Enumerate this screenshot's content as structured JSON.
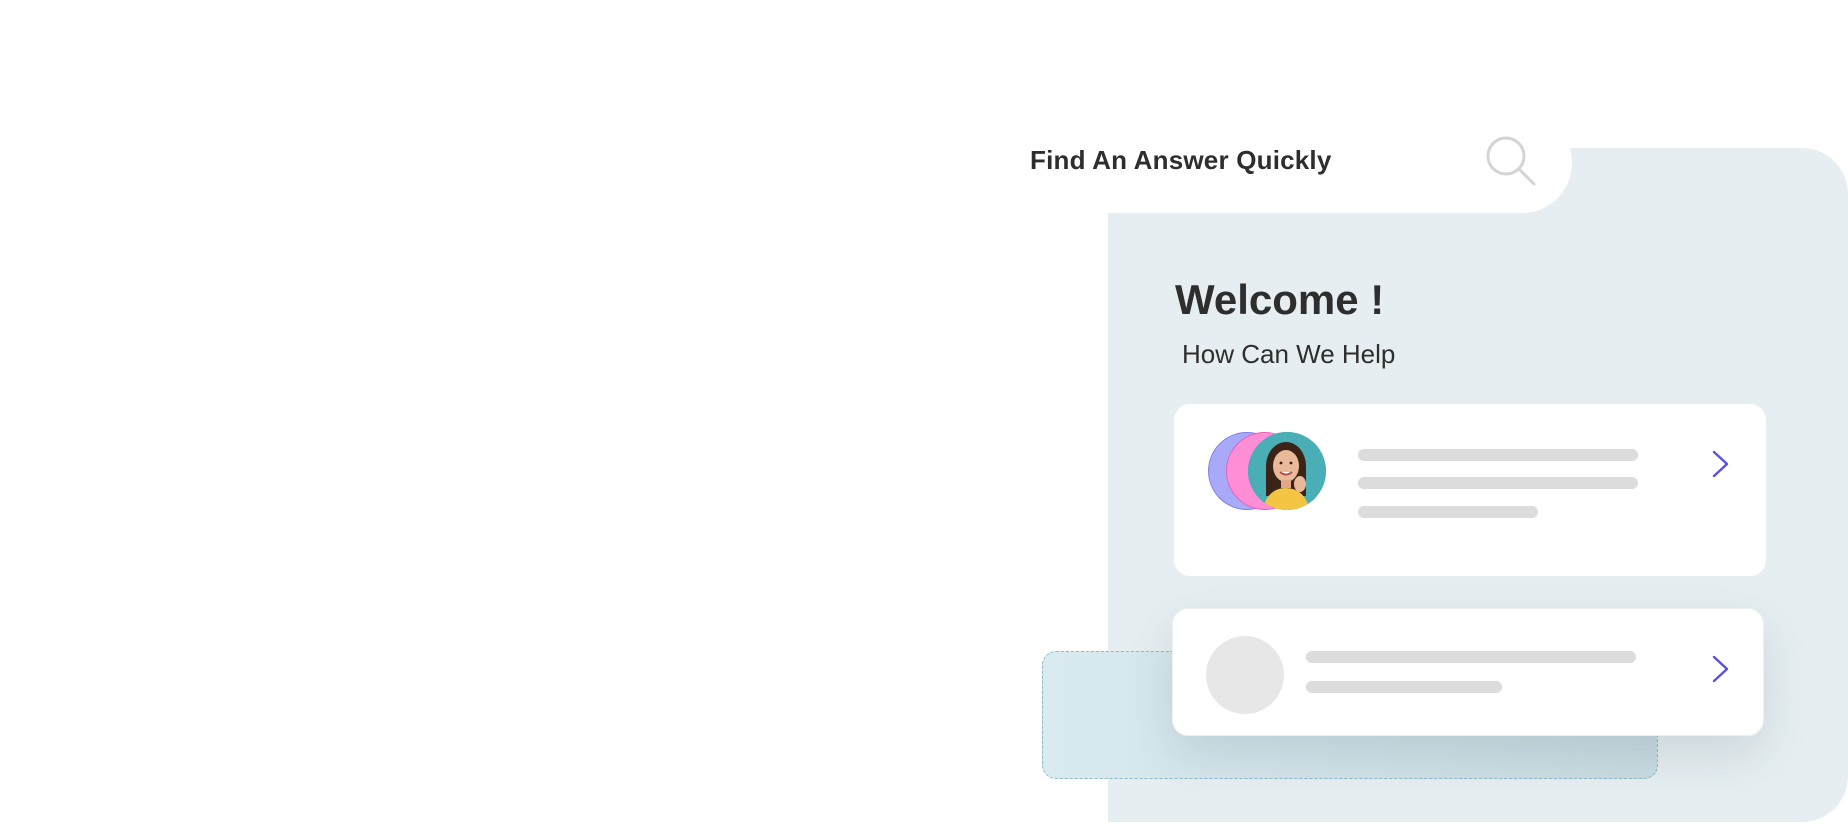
{
  "search": {
    "title": "Find An Answer Quickly",
    "icon": "search-icon"
  },
  "welcome": {
    "title": "Welcome !",
    "subtitle": "How Can We Help"
  },
  "cards": [
    {
      "avatar": "stacked-avatars",
      "chevron": "chevron-right-icon"
    },
    {
      "avatar": "avatar-placeholder",
      "chevron": "chevron-right-icon"
    }
  ],
  "colors": {
    "panel_bg": "#e6eef1",
    "accent": "#5a4fe6",
    "avatar_purple": "#a8a9f7",
    "avatar_pink": "#ff8ed6",
    "avatar_teal": "#49aeb6",
    "skeleton": "#dcdcdc",
    "text": "#2e2e2e"
  }
}
